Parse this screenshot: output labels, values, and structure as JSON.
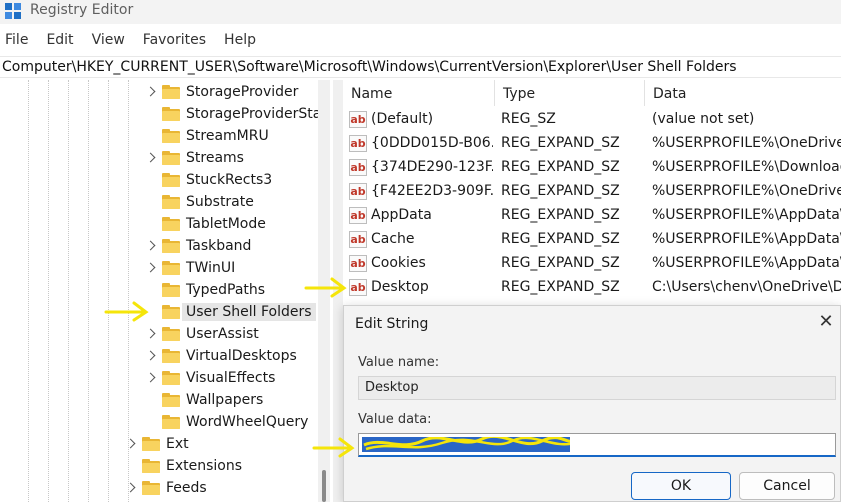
{
  "window": {
    "title": "Registry Editor",
    "app_icon": "registry-editor-icon"
  },
  "menu": [
    "File",
    "Edit",
    "View",
    "Favorites",
    "Help"
  ],
  "address": "Computer\\HKEY_CURRENT_USER\\Software\\Microsoft\\Windows\\CurrentVersion\\Explorer\\User Shell Folders",
  "tree": {
    "items": [
      {
        "label": "StorageProvider",
        "expandable": true
      },
      {
        "label": "StorageProviderStat",
        "expandable": false
      },
      {
        "label": "StreamMRU",
        "expandable": false
      },
      {
        "label": "Streams",
        "expandable": true
      },
      {
        "label": "StuckRects3",
        "expandable": false
      },
      {
        "label": "Substrate",
        "expandable": false
      },
      {
        "label": "TabletMode",
        "expandable": false
      },
      {
        "label": "Taskband",
        "expandable": true
      },
      {
        "label": "TWinUI",
        "expandable": true
      },
      {
        "label": "TypedPaths",
        "expandable": false
      },
      {
        "label": "User Shell Folders",
        "expandable": false,
        "selected": true
      },
      {
        "label": "UserAssist",
        "expandable": true
      },
      {
        "label": "VirtualDesktops",
        "expandable": true
      },
      {
        "label": "VisualEffects",
        "expandable": true
      },
      {
        "label": "Wallpapers",
        "expandable": false
      },
      {
        "label": "WordWheelQuery",
        "expandable": false
      },
      {
        "label": "Ext",
        "expandable": true
      },
      {
        "label": "Extensions",
        "expandable": false
      },
      {
        "label": "Feeds",
        "expandable": true
      }
    ]
  },
  "values": {
    "columns": [
      "Name",
      "Type",
      "Data"
    ],
    "rows": [
      {
        "name": "(Default)",
        "type": "REG_SZ",
        "data": "(value not set)"
      },
      {
        "name": "{0DDD015D-B06...",
        "type": "REG_EXPAND_SZ",
        "data": "%USERPROFILE%\\OneDrive\\P"
      },
      {
        "name": "{374DE290-123F...",
        "type": "REG_EXPAND_SZ",
        "data": "%USERPROFILE%\\Downloads"
      },
      {
        "name": "{F42EE2D3-909F...",
        "type": "REG_EXPAND_SZ",
        "data": "%USERPROFILE%\\OneDrive\\P"
      },
      {
        "name": "AppData",
        "type": "REG_EXPAND_SZ",
        "data": "%USERPROFILE%\\AppData\\R"
      },
      {
        "name": "Cache",
        "type": "REG_EXPAND_SZ",
        "data": "%USERPROFILE%\\AppData\\L"
      },
      {
        "name": "Cookies",
        "type": "REG_EXPAND_SZ",
        "data": "%USERPROFILE%\\AppData\\L"
      },
      {
        "name": "Desktop",
        "type": "REG_EXPAND_SZ",
        "data": "C:\\Users\\chenv\\OneDrive\\De"
      }
    ],
    "value_icon_text": "ab"
  },
  "dialog": {
    "title": "Edit String",
    "value_name_label": "Value name:",
    "value_name": "Desktop",
    "value_data_label": "Value data:",
    "ok_label": "OK",
    "cancel_label": "Cancel",
    "close_glyph": "✕"
  },
  "colors": {
    "annotation": "#f5e50a",
    "selection": "#2a66c6",
    "accent": "#1667c6"
  }
}
